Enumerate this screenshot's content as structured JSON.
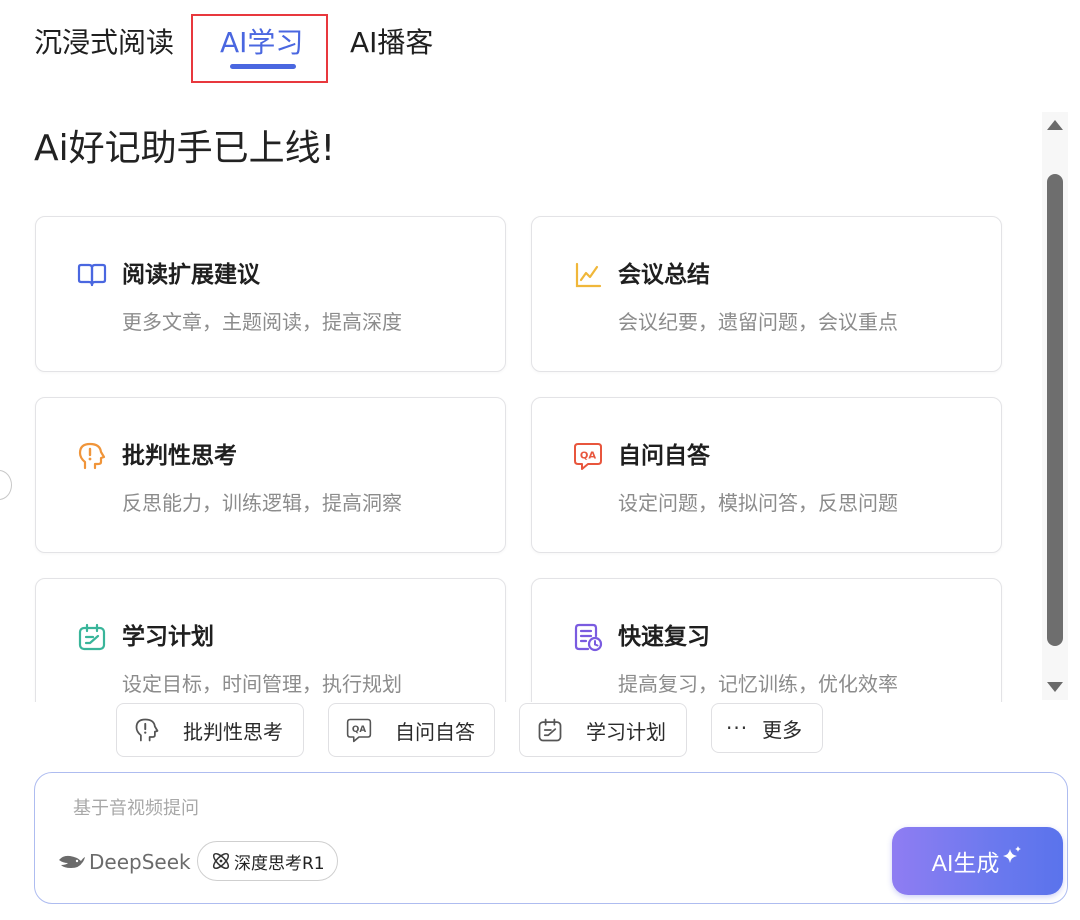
{
  "tabs": [
    {
      "label": "沉浸式阅读"
    },
    {
      "label": "AI学习"
    },
    {
      "label": "AI播客"
    }
  ],
  "heading": "Ai好记助手已上线!",
  "cards": [
    {
      "title": "阅读扩展建议",
      "desc": "更多文章，主题阅读，提高深度",
      "icon": "book-icon",
      "color": "#4a67e0"
    },
    {
      "title": "会议总结",
      "desc": "会议纪要，遗留问题，会议重点",
      "icon": "trend-chart-icon",
      "color": "#f0b73a"
    },
    {
      "title": "批判性思考",
      "desc": "反思能力，训练逻辑，提高洞察",
      "icon": "head-thinking-icon",
      "color": "#f0953a"
    },
    {
      "title": "自问自答",
      "desc": "设定问题，模拟问答，反思问题",
      "icon": "qa-bubble-icon",
      "color": "#e8563d"
    },
    {
      "title": "学习计划",
      "desc": "设定目标，时间管理，执行规划",
      "icon": "calendar-plan-icon",
      "color": "#39b59a"
    },
    {
      "title": "快速复习",
      "desc": "提高复习，记忆训练，优化效率",
      "icon": "review-doc-icon",
      "color": "#7a5be0"
    }
  ],
  "chips": [
    {
      "label": "批判性思考",
      "icon": "head-thinking-icon"
    },
    {
      "label": "自问自答",
      "icon": "qa-bubble-icon"
    },
    {
      "label": "学习计划",
      "icon": "calendar-plan-icon"
    },
    {
      "label": "更多",
      "icon": "more-dots-icon",
      "dots": "···"
    }
  ],
  "input": {
    "placeholder": "基于音视频提问",
    "model_name": "DeepSeek",
    "deep_think_label": "深度思考R1",
    "generate_label": "AI生成"
  }
}
